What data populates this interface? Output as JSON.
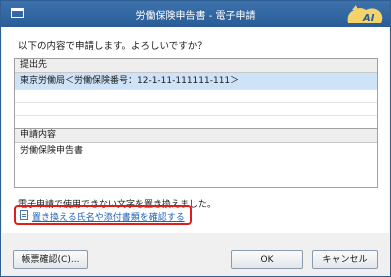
{
  "window": {
    "title": "労働保険申告書 - 電子申請",
    "logo_text": "AI"
  },
  "main": {
    "question": "以下の内容で申請します。よろしいですか？",
    "submit_to": {
      "header": "提出先",
      "rows": [
        "東京労働局＜労働保険番号：12-1-11-111111-111＞",
        "",
        ""
      ]
    },
    "application": {
      "header": "申請内容",
      "rows": [
        "労働保険申告書"
      ]
    },
    "notice": "電子申請で使用できない文字を置き換えました。",
    "link": "置き換える氏名や添付書類を確認する"
  },
  "footer": {
    "preview_button": "帳票確認(C)...",
    "ok_button": "OK",
    "cancel_button": "キャンセル"
  }
}
